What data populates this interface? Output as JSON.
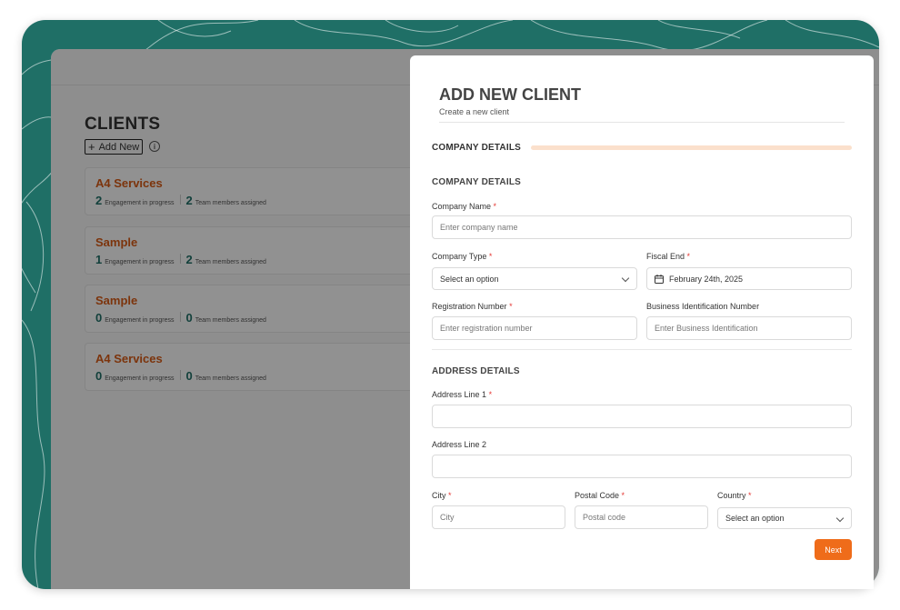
{
  "clients": {
    "title": "CLIENTS",
    "add_new_label": "Add New",
    "info_icon": "i",
    "items": [
      {
        "name": "A4 Services",
        "engagements": "2",
        "engagement_label": "Engagement in progress",
        "members": "2",
        "members_label": "Team members assigned"
      },
      {
        "name": "Sample",
        "engagements": "1",
        "engagement_label": "Engagement in progress",
        "members": "2",
        "members_label": "Team members assigned"
      },
      {
        "name": "Sample",
        "engagements": "0",
        "engagement_label": "Engagement in progress",
        "members": "0",
        "members_label": "Team members assigned"
      },
      {
        "name": "A4 Services",
        "engagements": "0",
        "engagement_label": "Engagement in progress",
        "members": "0",
        "members_label": "Team members assigned"
      }
    ]
  },
  "modal": {
    "title": "ADD NEW CLIENT",
    "subtitle": "Create a new client",
    "step_label": "COMPANY DETAILS",
    "company_section": "COMPANY DETAILS",
    "company_name_label": "Company Name",
    "company_name_placeholder": "Enter company name",
    "company_type_label": "Company Type",
    "company_type_value": "Select an option",
    "fiscal_end_label": "Fiscal End",
    "fiscal_end_value": "February 24th, 2025",
    "registration_label": "Registration Number",
    "registration_placeholder": "Enter registration number",
    "bin_label": "Business Identification Number",
    "bin_placeholder": "Enter Business Identification",
    "address_section": "ADDRESS DETAILS",
    "address1_label": "Address Line 1",
    "address2_label": "Address Line 2",
    "city_label": "City",
    "city_placeholder": "City",
    "postal_label": "Postal Code",
    "postal_placeholder": "Postal code",
    "country_label": "Country",
    "country_value": "Select an option",
    "required_mark": "*",
    "next_label": "Next"
  },
  "colors": {
    "brand_teal": "#1f6f66",
    "accent_orange": "#ef6c1a",
    "client_name": "#d65a16",
    "progress_track": "#fbe0cc"
  }
}
